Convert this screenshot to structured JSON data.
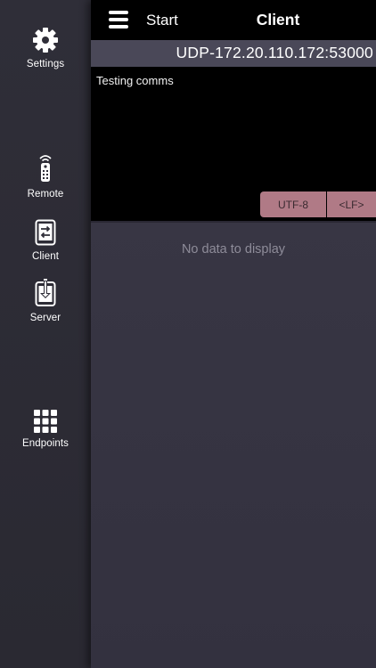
{
  "sidebar": {
    "items": [
      {
        "label": "Settings",
        "icon": "gear-icon"
      },
      {
        "label": "Remote",
        "icon": "remote-control-icon"
      },
      {
        "label": "Client",
        "icon": "client-transfer-icon"
      },
      {
        "label": "Server",
        "icon": "server-download-icon"
      },
      {
        "label": "Endpoints",
        "icon": "grid-icon"
      }
    ]
  },
  "header": {
    "menu_icon": "hamburger-menu-icon",
    "start_label": "Start",
    "title": "Client"
  },
  "connection": {
    "endpoint": "UDP-172.20.110.172:53000"
  },
  "input": {
    "text": "Testing comms",
    "encoding_button": "UTF-8",
    "line_ending_button": "<LF>"
  },
  "output": {
    "empty_message": "No data to display"
  },
  "colors": {
    "sidebar_bg": "#2f2e38",
    "main_bg": "#3a3846",
    "topbar_bg": "#000000",
    "endpoint_bar_bg": "#4a4858",
    "pill_bg": "#b07a86",
    "muted_text": "#8e8c99"
  }
}
